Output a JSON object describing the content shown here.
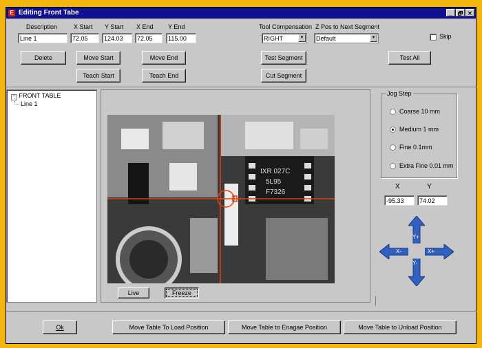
{
  "window": {
    "title": "Editing Front Tabe",
    "controls": [
      "_",
      "🗗",
      "✕"
    ]
  },
  "segment": {
    "description_label": "Description",
    "x_start_label": "X Start",
    "y_start_label": "Y Start",
    "x_end_label": "X End",
    "y_end_label": "Y End",
    "description": "Line 1",
    "x_start": "72.05",
    "y_start": "124.03",
    "x_end": "72.05",
    "y_end": "115.00",
    "tool_comp_label": "Tool Compensation",
    "tool_comp_value": "RIGHT",
    "z_pos_label": "Z Pos to Next Segment",
    "z_pos_value": "Default",
    "skip_label": "Skip"
  },
  "buttons": {
    "delete": "Delete",
    "move_start": "Move Start",
    "move_end": "Move End",
    "test_segment": "Test Segment",
    "test_all": "Test All",
    "teach_start": "Teach Start",
    "teach_end": "Teach End",
    "cut_segment": "Cut Segment",
    "live": "Live",
    "freeze": "Freeze",
    "ok": "Ok",
    "load_position": "Move Table To Load Position",
    "engage_position": "Move Table to Enagae Position",
    "unload_position": "Move Table to Unload Position"
  },
  "tree": {
    "root": "FRONT TABLE",
    "child": "Line 1"
  },
  "jog": {
    "title": "Jog Step",
    "options": [
      "Coarse 10 mm",
      "Medium 1 mm",
      "Fine 0.1mm",
      "Extra Fine 0.01 mm"
    ],
    "selected": "Medium 1 mm",
    "x_label": "X",
    "y_label": "Y",
    "x_value": "-95.33",
    "y_value": "74.02",
    "arrow_labels": {
      "up": "Y+",
      "down": "Y-",
      "left": "X-",
      "right": "X+"
    },
    "arrow_color": "#3060c0"
  },
  "camera": {
    "chip_text": [
      "IXR 027C",
      "5L95",
      "F7326"
    ],
    "crosshair_color": "#e04010"
  }
}
